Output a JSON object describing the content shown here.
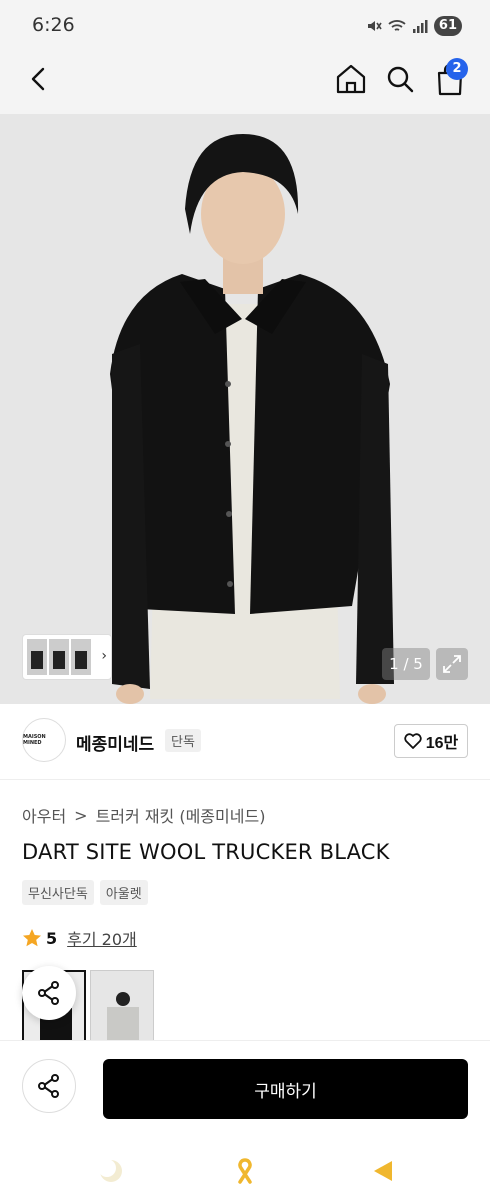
{
  "status_bar": {
    "time": "6:26",
    "battery": "61"
  },
  "header": {
    "cart_count": "2"
  },
  "image_gallery": {
    "counter": "1 / 5"
  },
  "brand": {
    "logo_text": "MAISON MINED",
    "name": "메종미네드",
    "tag": "단독",
    "likes": "16만"
  },
  "breadcrumb": {
    "category": "아우터",
    "separator": ">",
    "subcategory": "트러커 재킷 (메종미네드)"
  },
  "product": {
    "title": "DART SITE WOOL TRUCKER BLACK",
    "tags": [
      "무신사단독",
      "아울렛"
    ],
    "rating": "5",
    "reviews": "후기 20개"
  },
  "actions": {
    "buy_label": "구매하기"
  },
  "colors": {
    "accent": "#2563eb",
    "star": "#f5a623",
    "primary_button": "#000000"
  }
}
